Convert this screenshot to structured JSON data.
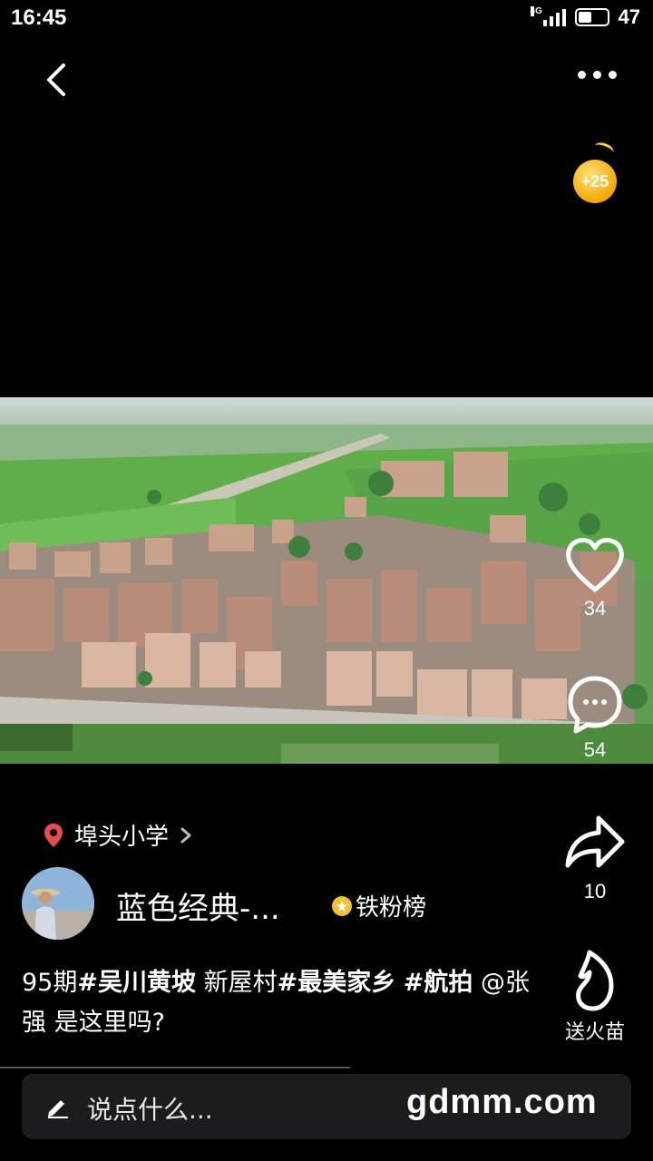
{
  "status_bar": {
    "time": "16:45",
    "network": "4G",
    "battery": "47"
  },
  "reward_coin": {
    "label": "+25"
  },
  "side_actions": {
    "like_count": "34",
    "comment_count": "54",
    "share_count": "10",
    "gift_label": "送火苗"
  },
  "location": {
    "name": "埠头小学"
  },
  "author": {
    "name": "蓝色经典-...",
    "badge": "铁粉榜"
  },
  "caption": {
    "part1": "95期",
    "tag1": "#吴川黄坡",
    "part2": " 新屋村",
    "tag2": "#最美家乡",
    "part3": " ",
    "tag3": "#航拍",
    "mention": " @张强",
    "part4": " 是这里吗?"
  },
  "comment_bar": {
    "placeholder": "说点什么..."
  },
  "watermark": "gdmm.com",
  "colors": {
    "location_pin": "#e84b4b",
    "coin": "#f5a800",
    "badge": "#f2c230"
  }
}
